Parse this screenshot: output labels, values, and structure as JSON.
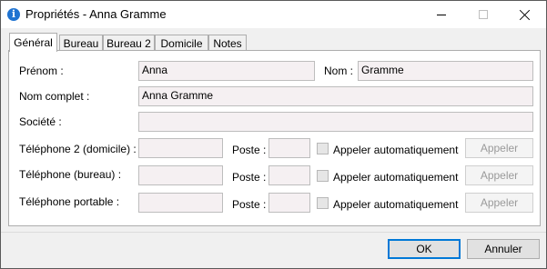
{
  "window": {
    "title": "Propriétés - Anna Gramme",
    "icon": "info-icon"
  },
  "tabs": [
    {
      "label": "Général",
      "active": true
    },
    {
      "label": "Bureau",
      "active": false
    },
    {
      "label": "Bureau 2",
      "active": false
    },
    {
      "label": "Domicile",
      "active": false
    },
    {
      "label": "Notes",
      "active": false
    }
  ],
  "form": {
    "prenom_label": "Prénom :",
    "prenom_value": "Anna",
    "nom_label": "Nom :",
    "nom_value": "Gramme",
    "nom_complet_label": "Nom complet :",
    "nom_complet_value": "Anna Gramme",
    "societe_label": "Société :",
    "societe_value": "",
    "phones": [
      {
        "label": "Téléphone 2 (domicile) :",
        "value": "",
        "poste_label": "Poste :",
        "poste_value": "",
        "auto_label": "Appeler automatiquement",
        "auto_checked": false,
        "call_label": "Appeler"
      },
      {
        "label": "Téléphone (bureau) :",
        "value": "",
        "poste_label": "Poste :",
        "poste_value": "",
        "auto_label": "Appeler automatiquement",
        "auto_checked": false,
        "call_label": "Appeler"
      },
      {
        "label": "Téléphone portable :",
        "value": "",
        "poste_label": "Poste :",
        "poste_value": "",
        "auto_label": "Appeler automatiquement",
        "auto_checked": false,
        "call_label": "Appeler"
      }
    ]
  },
  "footer": {
    "ok_label": "OK",
    "cancel_label": "Annuler"
  }
}
